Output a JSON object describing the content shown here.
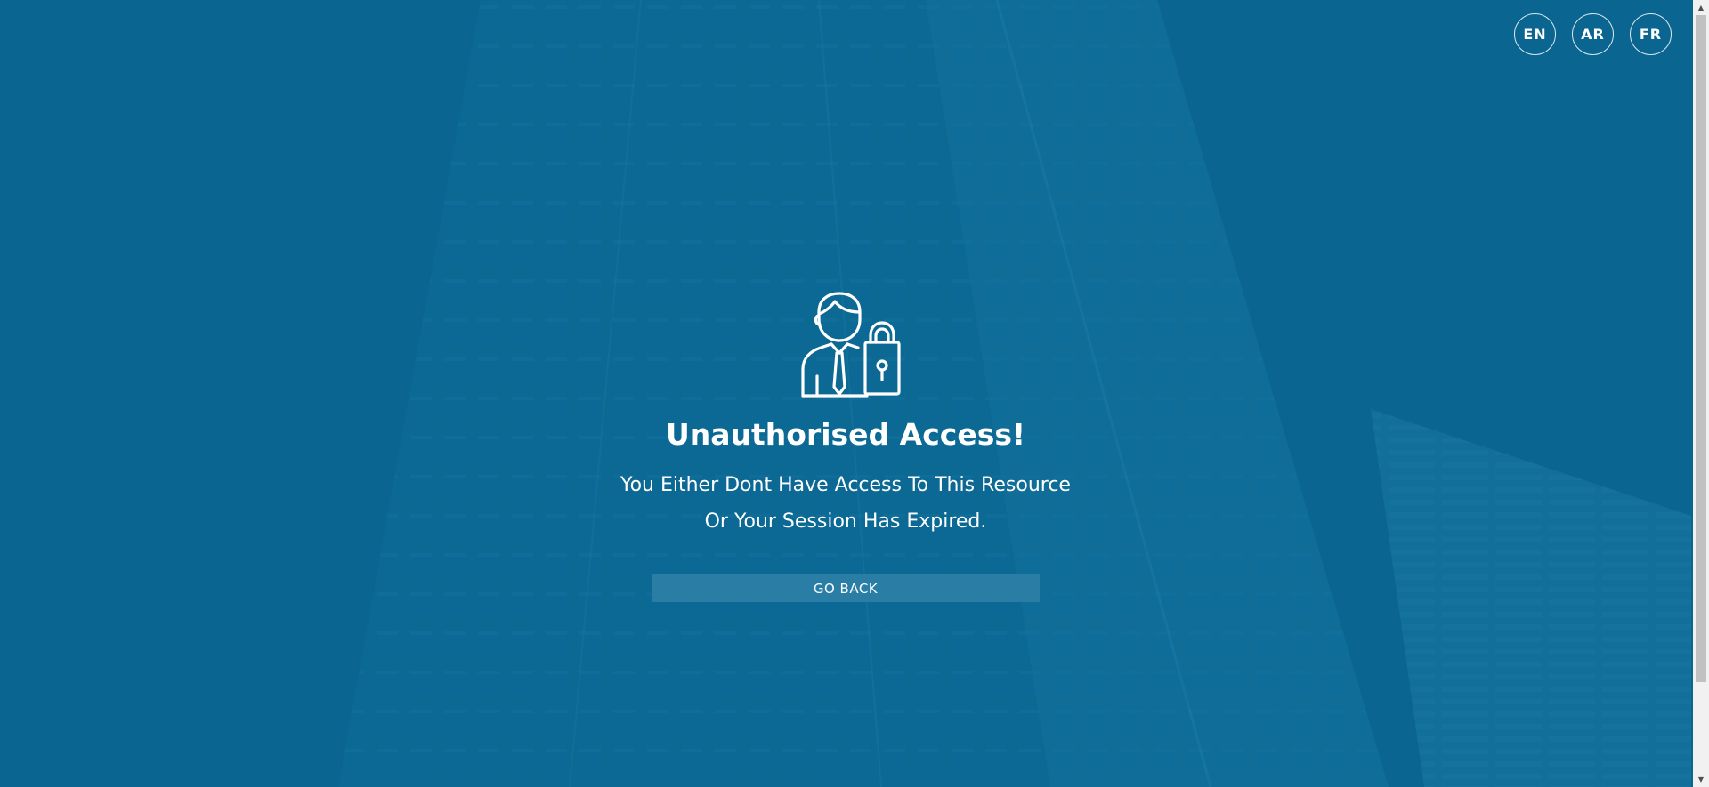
{
  "languages": {
    "en": "EN",
    "ar": "AR",
    "fr": "FR"
  },
  "error": {
    "title": "Unauthorised Access!",
    "message_line1": "You Either Dont Have Access To This Resource",
    "message_line2": "Or Your Session Has Expired.",
    "icon": "user-lock-icon"
  },
  "actions": {
    "go_back_label": "GO BACK"
  },
  "colors": {
    "background": "#0a6590",
    "button": "#2a7ea5",
    "text": "#ffffff"
  }
}
